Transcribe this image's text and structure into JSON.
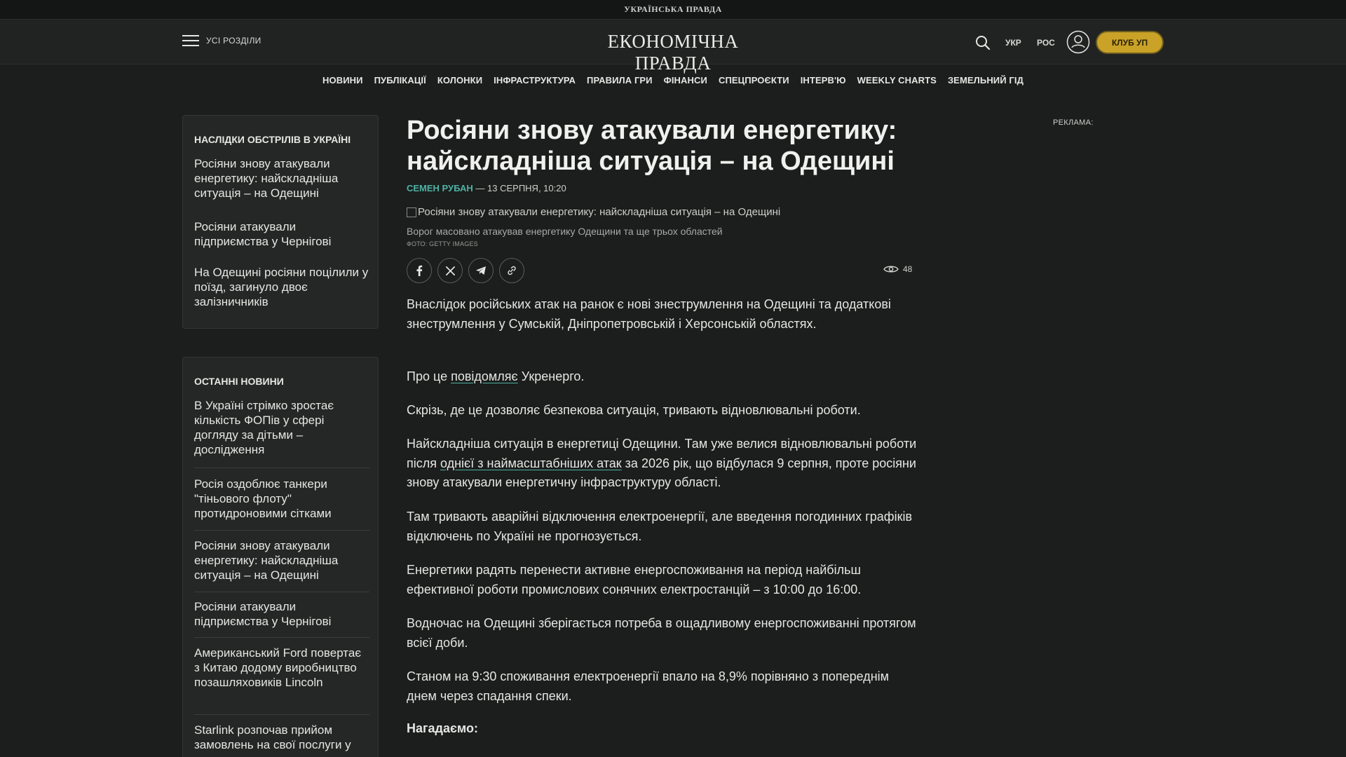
{
  "topstrip": {
    "brand": "УКРАЇНСЬКА ПРАВДА"
  },
  "header": {
    "menu_label": "УСІ РОЗДІЛИ",
    "logo": "ЕКОНОМІЧНА ПРАВДА",
    "lang_ukr": "УКР",
    "lang_ros": "РОС",
    "club_label": "КЛУБ УП",
    "accent": "#c9a227"
  },
  "nav": {
    "items": [
      "НОВИНИ",
      "ПУБЛІКАЦІЇ",
      "КОЛОНКИ",
      "ІНФРАСТРУКТУРА",
      "ПРАВИЛА ГРИ",
      "ФІНАНСИ",
      "СПЕЦПРОЄКТИ",
      "ІНТЕРВ'Ю",
      "WEEKLY CHARTS",
      "ЗЕМЕЛЬНИЙ ГІД"
    ]
  },
  "sidebar": {
    "topic": {
      "title": "НАСЛІДКИ ОБСТРІЛІВ В УКРАЇНІ",
      "items": [
        "Росіяни знову атакували енергетику: найскладніша ситуація – на Одещині",
        "Росіяни атакували підприємства у Чернігові",
        "На Одещині росіяни поцілили у поїзд, загинуло двоє залізничників"
      ]
    },
    "latest": {
      "title": "ОСТАННІ НОВИНИ",
      "items": [
        "В Україні стрімко зростає кількість ФОПів у сфері догляду за дітьми – дослідження",
        "Росія оздоблює танкери \"тіньового флоту\" протидроновими сітками",
        "Росіяни знову атакували енергетику: найскладніша ситуація – на Одещині",
        "Росіяни атакували підприємства у Чернігові",
        "Американський Ford повертає з Китаю додому виробництво позашляховиків Lincoln",
        "Starlink розпочав прийом замовлень на свої послуги у"
      ]
    }
  },
  "article": {
    "title": "Росіяни знову атакували енергетику: найскладніша ситуація – на Одещині",
    "author": "СЕМЕН РУБАН",
    "date_sep": " — ",
    "date": "13 СЕРПНЯ, 10:20",
    "image_alt": "Росіяни знову атакували енергетику: найскладніша ситуація – на Одещині",
    "caption": "Ворог масовано атакував енергетику Одещини та ще трьох областей",
    "photo_credit": "ФОТО: GETTY IMAGES",
    "views": "48",
    "p1": "Внаслідок російських атак на ранок є нові знеструмлення на Одещині та додаткові знеструмлення у Сумській, Дніпропетровській і Херсонській областях.",
    "p2_before": "Про це ",
    "p2_link": "повідомляє",
    "p2_after": " Укренерго.",
    "p3": "Скрізь, де це дозволяє безпекова ситуація, тривають відновлювальні роботи.",
    "p4_before": "Найскладніша ситуація в енергетиці Одещини. Там уже велися відновлювальні роботи після ",
    "p4_link": "однієї з наймасштабніших атак",
    "p4_after": " за 2026 рік, що відбулася 9 серпня, проте росіяни знову атакували енергетичну інфраструктуру області.",
    "p5": "Там тривають аварійні відключення електроенергії, але введення погодинних графіків відключень по Україні не прогнозується.",
    "p6": "Енергетики радять перенести активне енергоспоживання на період найбільш ефективної роботи промислових сонячних електростанцій – з 10:00 до 16:00.",
    "p7": "Водночас на Одещині зберігається потреба в ощадливому енергоспоживанні протягом всієї доби.",
    "p8": "Станом на 9:30 споживання електроенергії впало на 8,9% порівняно з попереднім днем через спадання спеки.",
    "p9": "Нагадаємо:",
    "accent": "#4fb1a6"
  },
  "ad": {
    "label": "РЕКЛАМА:"
  }
}
